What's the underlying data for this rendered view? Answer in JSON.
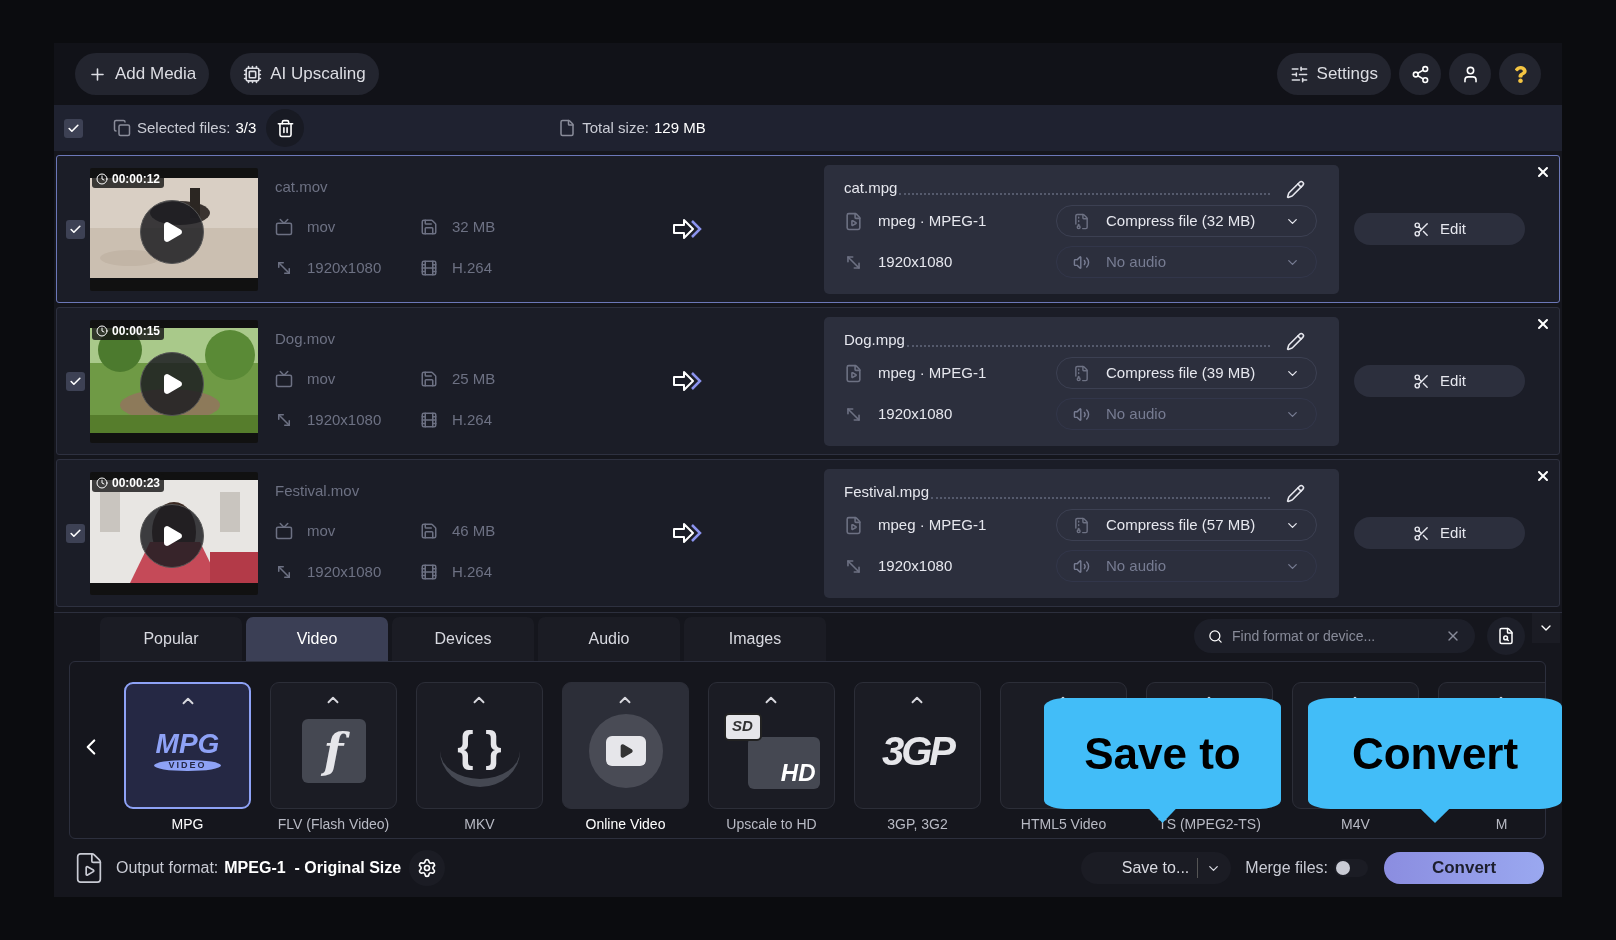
{
  "toolbar": {
    "buttons": [
      {
        "kind": "add",
        "label": "Add Media"
      },
      {
        "kind": "ai",
        "label": "AI Upscaling"
      }
    ],
    "settings": "Settings"
  },
  "selection_bar": {
    "checked": true,
    "selected_label": "Selected files:",
    "selected_count": "3/3",
    "total_label": "Total size:",
    "total_size": "129 MB"
  },
  "files": [
    {
      "checked": true,
      "selected": true,
      "duration": "00:00:12",
      "name": "cat.mov",
      "container": "mov",
      "size": "32 MB",
      "resolution": "1920x1080",
      "codec": "H.264",
      "output": {
        "name": "cat.mpg",
        "format": "mpeg · MPEG-1",
        "compress": "Compress file (32 MB)",
        "resolution": "1920x1080",
        "audio": "No audio",
        "audio_disabled": true
      },
      "edit": "Edit"
    },
    {
      "checked": true,
      "selected": false,
      "duration": "00:00:15",
      "name": "Dog.mov",
      "container": "mov",
      "size": "25 MB",
      "resolution": "1920x1080",
      "codec": "H.264",
      "output": {
        "name": "Dog.mpg",
        "format": "mpeg · MPEG-1",
        "compress": "Compress file (39 MB)",
        "resolution": "1920x1080",
        "audio": "No audio",
        "audio_disabled": true
      },
      "edit": "Edit"
    },
    {
      "checked": true,
      "selected": false,
      "duration": "00:00:23",
      "name": "Festival.mov",
      "container": "mov",
      "size": "46 MB",
      "resolution": "1920x1080",
      "codec": "H.264",
      "output": {
        "name": "Festival.mpg",
        "format": "mpeg · MPEG-1",
        "compress": "Compress file (57 MB)",
        "resolution": "1920x1080",
        "audio": "No audio",
        "audio_disabled": true
      },
      "edit": "Edit"
    }
  ],
  "format_tabs": [
    {
      "label": "Popular",
      "selected": false
    },
    {
      "label": "Video",
      "selected": true
    },
    {
      "label": "Devices",
      "selected": false
    },
    {
      "label": "Audio",
      "selected": false
    },
    {
      "label": "Images",
      "selected": false
    }
  ],
  "search": {
    "placeholder": "Find format or device..."
  },
  "formats": [
    {
      "kind": "mpg",
      "logo": [
        "MPG",
        "VIDEO"
      ],
      "label": "MPG",
      "selected": true,
      "highlighted": false
    },
    {
      "kind": "flv",
      "logo": [
        "f"
      ],
      "label": "FLV (Flash Video)",
      "selected": false,
      "highlighted": false
    },
    {
      "kind": "mkv",
      "logo": [
        "{ }"
      ],
      "label": "MKV",
      "selected": false,
      "highlighted": false
    },
    {
      "kind": "online",
      "label": "Online Video",
      "selected": false,
      "highlighted": true
    },
    {
      "kind": "upscale",
      "logo": [
        "SD",
        "HD"
      ],
      "label": "Upscale to HD",
      "selected": false,
      "highlighted": false
    },
    {
      "kind": "threegp",
      "logo": [
        "3GP"
      ],
      "label": "3GP, 3G2",
      "selected": false,
      "highlighted": false
    },
    {
      "kind": "hidden",
      "label": "HTML5 Video",
      "selected": false,
      "highlighted": false
    },
    {
      "kind": "hidden",
      "label": "TS (MPEG2-TS)",
      "selected": false,
      "highlighted": false
    },
    {
      "kind": "hidden",
      "label": "M4V",
      "selected": false,
      "highlighted": false
    },
    {
      "kind": "hidden",
      "label": "M",
      "selected": false,
      "highlighted": false
    }
  ],
  "bottom_bar": {
    "output_label": "Output format:",
    "output_value": "MPEG-1  - Original Size",
    "save_to": "Save to...",
    "merge_label": "Merge files:",
    "merge_on": false,
    "convert": "Convert"
  },
  "callouts": [
    {
      "text": "Save to"
    },
    {
      "text": "Convert"
    }
  ]
}
